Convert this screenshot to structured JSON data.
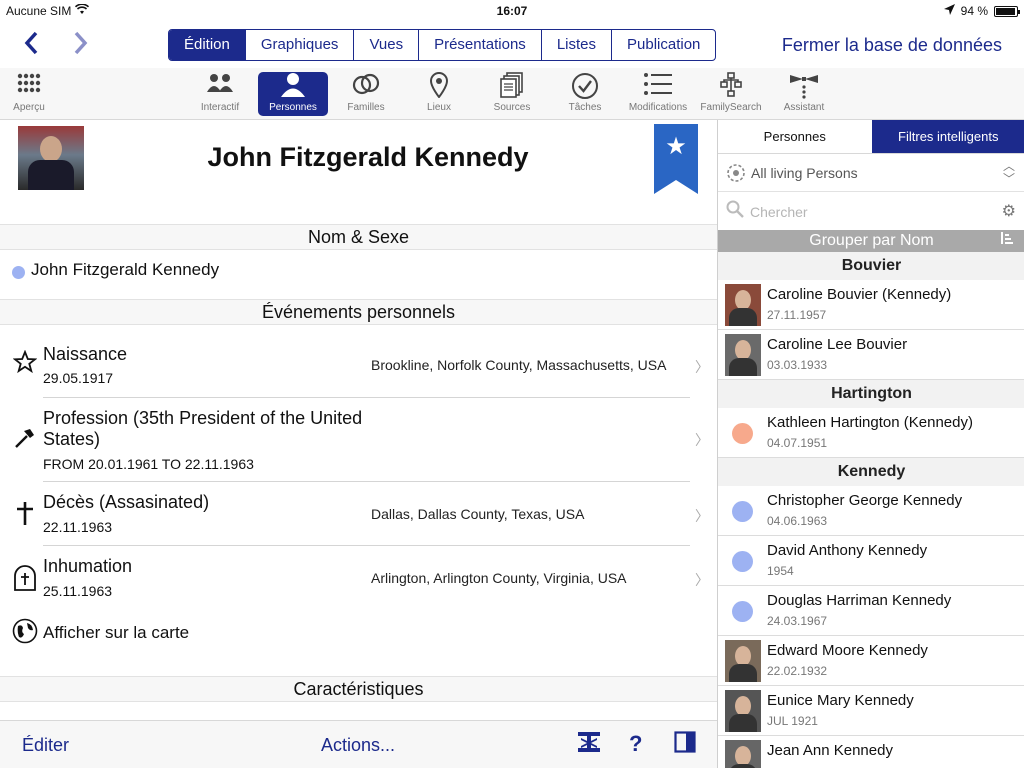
{
  "status_bar": {
    "carrier": "Aucune SIM",
    "time": "16:07",
    "battery": "94 %"
  },
  "nav": {
    "tabs": [
      "Édition",
      "Graphiques",
      "Vues",
      "Présentations",
      "Listes",
      "Publication"
    ],
    "active_tab": "Édition",
    "close_db": "Fermer la base de données"
  },
  "toolbar": {
    "items": [
      {
        "label": "Aperçu",
        "icon": "grid-icon"
      },
      {
        "label": "Interactif",
        "icon": "people-icon"
      },
      {
        "label": "Personnes",
        "icon": "person-icon"
      },
      {
        "label": "Familles",
        "icon": "rings-icon"
      },
      {
        "label": "Lieux",
        "icon": "pin-icon"
      },
      {
        "label": "Sources",
        "icon": "documents-icon"
      },
      {
        "label": "Tâches",
        "icon": "check-icon"
      },
      {
        "label": "Modifications",
        "icon": "list-icon"
      },
      {
        "label": "FamilySearch",
        "icon": "tree-icon"
      },
      {
        "label": "Assistant",
        "icon": "butler-icon"
      }
    ],
    "active": "Personnes"
  },
  "person": {
    "name": "John Fitzgerald Kennedy",
    "sections": {
      "name_sex": "Nom & Sexe",
      "events": "Événements personnels",
      "characteristics": "Caractéristiques"
    },
    "name_entry": "John Fitzgerald Kennedy",
    "events": [
      {
        "title": "Naissance",
        "date": "29.05.1917",
        "place": "Brookline, Norfolk County, Massachusetts, USA",
        "icon": "star-icon"
      },
      {
        "title": "Profession (35th President of the United States)",
        "date": "FROM 20.01.1961 TO 22.11.1963",
        "place": "",
        "icon": "hammer-icon"
      },
      {
        "title": "Décès (Assasinated)",
        "date": "22.11.1963",
        "place": "Dallas, Dallas County, Texas, USA",
        "icon": "cross-icon"
      },
      {
        "title": "Inhumation",
        "date": "25.11.1963",
        "place": "Arlington, Arlington County, Virginia, USA",
        "icon": "tomb-icon"
      }
    ],
    "map_link": "Afficher sur la carte"
  },
  "bottom_bar": {
    "edit": "Éditer",
    "actions": "Actions..."
  },
  "sidebar": {
    "tabs": [
      "Personnes",
      "Filtres intelligents"
    ],
    "active_tab": "Filtres intelligents",
    "filter": "All living Persons",
    "search_placeholder": "Chercher",
    "group_by": "Grouper par Nom",
    "groups": [
      {
        "name": "Bouvier",
        "people": [
          {
            "name": "Caroline Bouvier (Kennedy)",
            "date": "27.11.1957",
            "photo": true,
            "bg": "#8a4a3a"
          },
          {
            "name": "Caroline Lee Bouvier",
            "date": "03.03.1933",
            "photo": true,
            "bg": "#6a6a6a"
          }
        ]
      },
      {
        "name": "Hartington",
        "people": [
          {
            "name": "Kathleen Hartington (Kennedy)",
            "date": "04.07.1951",
            "photo": false,
            "dot": "#f7a98c"
          }
        ]
      },
      {
        "name": "Kennedy",
        "people": [
          {
            "name": "Christopher George Kennedy",
            "date": "04.06.1963",
            "photo": false,
            "dot": "#9db2f2"
          },
          {
            "name": "David Anthony Kennedy",
            "date": "1954",
            "photo": false,
            "dot": "#9db2f2"
          },
          {
            "name": "Douglas Harriman Kennedy",
            "date": "24.03.1967",
            "photo": false,
            "dot": "#9db2f2"
          },
          {
            "name": "Edward Moore Kennedy",
            "date": "22.02.1932",
            "photo": true,
            "bg": "#7a6a5a"
          },
          {
            "name": "Eunice Mary Kennedy",
            "date": "JUL 1921",
            "photo": true,
            "bg": "#555"
          },
          {
            "name": "Jean Ann Kennedy",
            "date": "",
            "photo": true,
            "bg": "#666"
          }
        ]
      }
    ]
  }
}
